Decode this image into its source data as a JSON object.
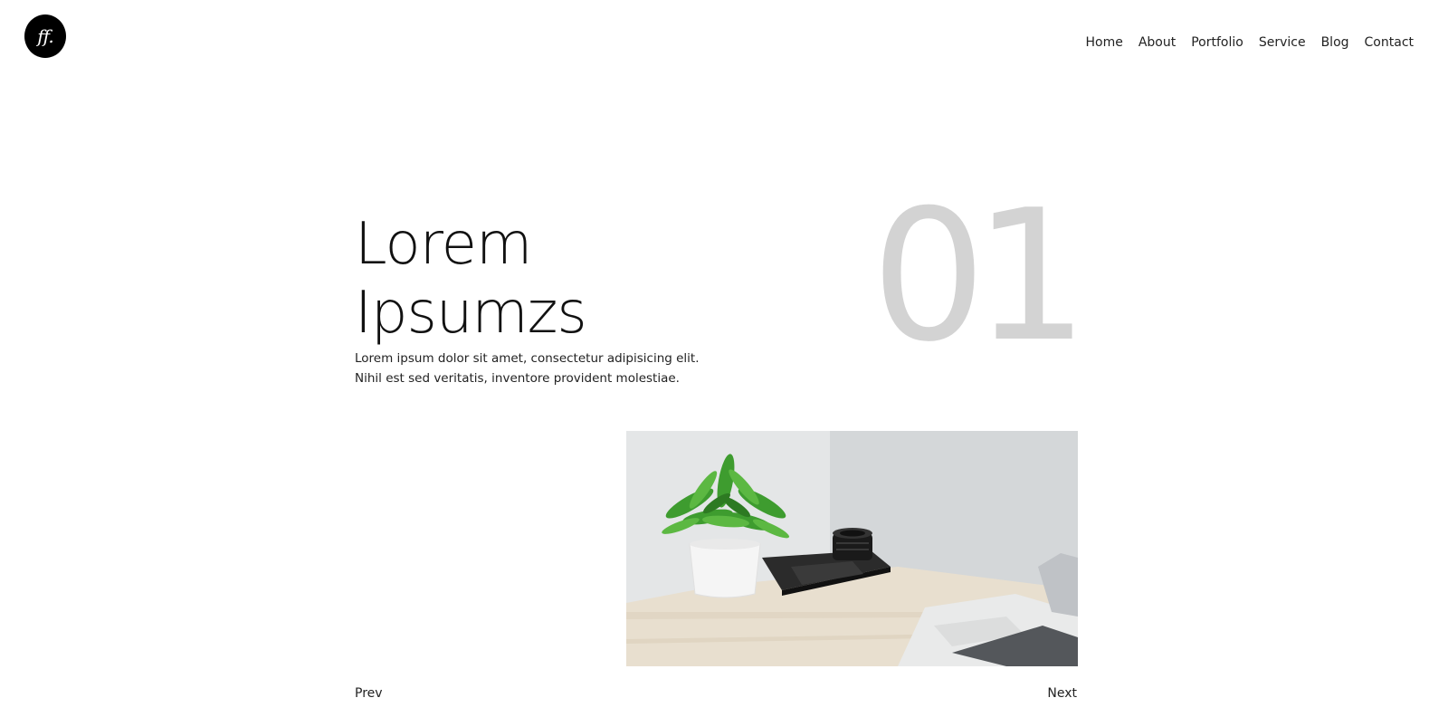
{
  "logo": {
    "text": "ff."
  },
  "nav": {
    "items": [
      "Home",
      "About",
      "Portfolio",
      "Service",
      "Blog",
      "Contact"
    ]
  },
  "hero": {
    "title_line1": "Lorem",
    "title_line2": "Ipsumzs",
    "text_line1": "Lorem ipsum dolor sit amet, consectetur adipisicing elit.",
    "text_line2": "Nihil est sed veritatis, inventore provident molestiae.",
    "slide_number": "01"
  },
  "pager": {
    "prev": "Prev",
    "next": "Next"
  }
}
